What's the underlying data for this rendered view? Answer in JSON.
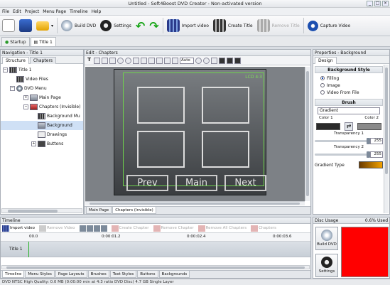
{
  "window": {
    "title": "Untitled - Soft4Boost DVD Creator - Non-activated version",
    "min": "_",
    "max": "□",
    "close": "×"
  },
  "menu": [
    "File",
    "Edit",
    "Project",
    "Menu Page",
    "Timeline",
    "Help"
  ],
  "toolbar": {
    "build_dvd": "Build DVD",
    "settings": "Settings",
    "import_video": "Import video",
    "create_title": "Create Title",
    "remove_title": "Remove Title",
    "capture_video": "Capture Video"
  },
  "tabs": {
    "startup": "Startup",
    "title1": "Title 1"
  },
  "navigation": {
    "header": "Navigation - Title 1",
    "tabs": [
      "Structure",
      "Chapters"
    ],
    "tree": {
      "title": "Title 1",
      "video_files": "Video Files",
      "dvd_menu": "DVD Menu",
      "main_page": "Main Page",
      "chapters": "Chapters (Invisible)",
      "background_music": "Background Mu",
      "background": "Background",
      "drawings": "Drawings",
      "buttons": "Buttons"
    }
  },
  "editor": {
    "header": "Edit - Chapters",
    "zoom": "Auto",
    "lcd_label": "LCD 4:3",
    "buttons": {
      "prev": "Prev",
      "main": "Main",
      "next": "Next"
    },
    "page_tabs": [
      "Main Page",
      "Chapters (Invisible)"
    ]
  },
  "properties": {
    "header": "Properties - Background",
    "tab": "Design",
    "bg_style": "Background Style",
    "radios": [
      "Filling",
      "Image",
      "Video From File"
    ],
    "brush": "Brush",
    "brush_type": "Gradient",
    "color1": "Color 1",
    "color2": "Color 2",
    "trans1_label": "Transparency 1",
    "trans1": "255",
    "trans2_label": "Transparency 2",
    "trans2": "255",
    "gradient_type": "Gradient Type",
    "colors": {
      "color1": "#2b2b2b",
      "color2": "#8a8a8a"
    }
  },
  "timeline": {
    "header": "Timeline",
    "import_video": "Import video",
    "remove_video": "Remove Video",
    "create_chapter": "Create Chapter",
    "remove_chapter": "Remove Chapter",
    "remove_all": "Remove All Chapters",
    "chapters": "Chapters",
    "times": [
      "00.0",
      "0:00:01.2",
      "0:00:02.4",
      "0:00:03.6"
    ],
    "track": "Title 1",
    "tabs": [
      "Timeline",
      "Menu Styles",
      "Page Layouts",
      "Brushes",
      "Text Styles",
      "Buttons",
      "Backgrounds"
    ]
  },
  "disc": {
    "header": "Disc Usage",
    "usage": "0.6% Used",
    "build": "Build DVD",
    "settings": "Settings",
    "bar_color": "#ff0000"
  },
  "status": "DVD NTSC    High Quality: 0.0 MB (0:00:00 min at 4:3 ratio DVD Disc)          4.7 GB Single Layer"
}
